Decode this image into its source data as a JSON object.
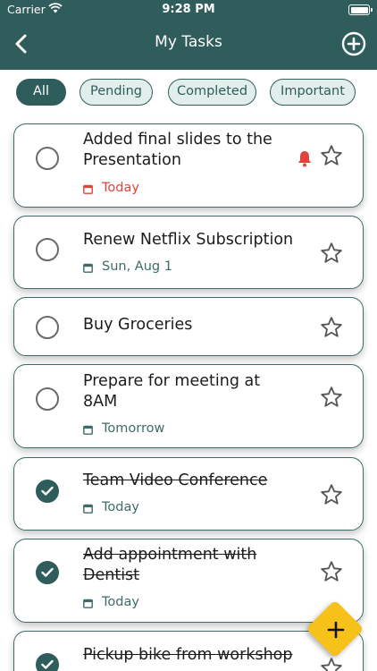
{
  "status_bar": {
    "carrier": "Carrier",
    "time": "9:28 PM"
  },
  "nav": {
    "title": "My Tasks",
    "back_icon": "chevron-left-icon",
    "add_icon": "plus-circle-icon"
  },
  "filters": [
    {
      "label": "All",
      "active": true
    },
    {
      "label": "Pending",
      "active": false
    },
    {
      "label": "Completed",
      "active": false
    },
    {
      "label": "Important",
      "active": false
    }
  ],
  "tasks": [
    {
      "title_line1": "Added final slides to the",
      "title_line2": "Presentation",
      "date": "Today",
      "completed": false,
      "alert": true
    },
    {
      "title_line1": "Renew Netflix Subscription",
      "title_line2": "",
      "date": "Sun, Aug 1",
      "completed": false,
      "alert": false
    },
    {
      "title_line1": "Buy Groceries",
      "title_line2": "",
      "date": "",
      "completed": false,
      "alert": false
    },
    {
      "title_line1": "Prepare for meeting at",
      "title_line2": "8AM",
      "date": "Tomorrow",
      "completed": false,
      "alert": false
    },
    {
      "title_line1": "Team Video Conference",
      "title_line2": "",
      "date": "Today",
      "completed": true,
      "alert": false
    },
    {
      "title_line1": "Add appointment with",
      "title_line2": "Dentist",
      "date": "Today",
      "completed": true,
      "alert": false
    },
    {
      "title_line1": "Pickup bike from workshop",
      "title_line2": "",
      "date": "",
      "completed": true,
      "alert": false
    }
  ],
  "colors": {
    "primary": "#2f5d5b",
    "accent_fab": "#f6c21a",
    "alert_red": "#e0443b"
  }
}
